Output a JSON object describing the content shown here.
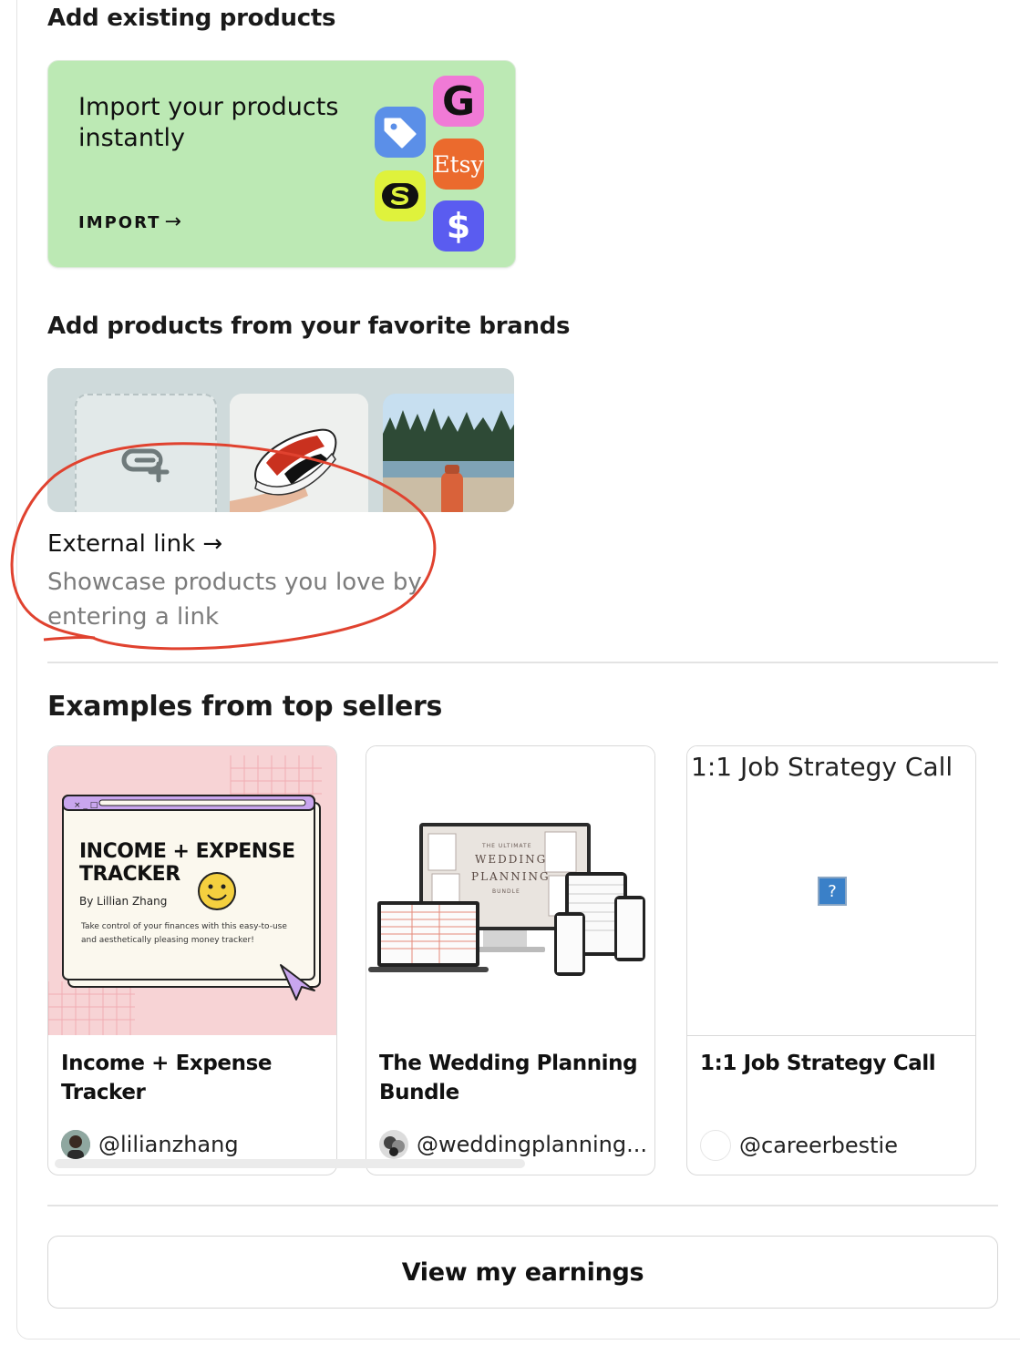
{
  "sections": {
    "existing_heading": "Add existing products",
    "brands_heading": "Add products from your favorite brands",
    "examples_heading": "Examples from top sellers"
  },
  "import_card": {
    "title": "Import your products instantly",
    "link_label": "IMPORT",
    "tiles": [
      {
        "icon": "g-logo-icon",
        "text": "G",
        "color": "#f07ad6"
      },
      {
        "icon": "price-tag-icon",
        "text": "",
        "color": "#5b8fe8"
      },
      {
        "icon": "etsy-logo-icon",
        "text": "Etsy",
        "color": "#eb6a2d"
      },
      {
        "icon": "s-logo-icon",
        "text": "",
        "color": "#dff23c"
      },
      {
        "icon": "dollar-icon",
        "text": "$",
        "color": "#5a5cf0"
      }
    ]
  },
  "external_link": {
    "title": "External link",
    "description": "Showcase products you love by entering a link"
  },
  "examples": [
    {
      "title": "Income + Expense Tracker",
      "handle": "@lilianzhang",
      "thumb": {
        "heading_line1": "INCOME + EXPENSE",
        "heading_line2": "TRACKER",
        "byline": "By Lillian Zhang",
        "blurb": "Take control of your finances with this easy-to-use and aesthetically pleasing money tracker!",
        "window_controls": "× _ □"
      }
    },
    {
      "title": "The Wedding Planning Bundle",
      "handle": "@weddingplanning...",
      "thumb": {
        "line1": "THE ULTIMATE",
        "line2": "WEDDING",
        "line3": "PLANNING",
        "line4": "BUNDLE"
      }
    },
    {
      "title": "1:1 Job Strategy Call",
      "handle": "@careerbestie",
      "thumb": {
        "alt_text": "1:1 Job Strategy Call",
        "broken_icon": "?"
      }
    }
  ],
  "earnings_button": "View my earnings",
  "colors": {
    "import_bg": "#bce9b4",
    "brand_bg": "#cfdadb",
    "annotation": "#e0422f"
  }
}
